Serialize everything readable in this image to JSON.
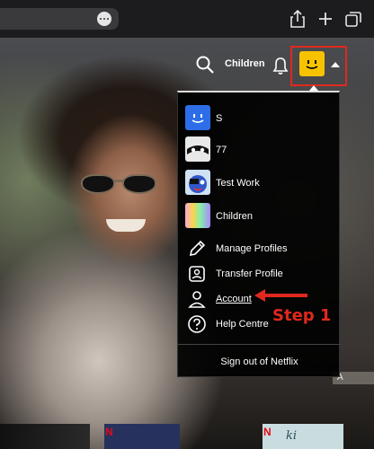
{
  "browser": {
    "icons": [
      "more-icon",
      "share-icon",
      "plus-icon",
      "tabs-icon"
    ]
  },
  "header": {
    "children_link": "Children",
    "icons": [
      "search-icon",
      "bell-icon",
      "caret-down-icon"
    ],
    "avatar_color": "#f7c200"
  },
  "menu": {
    "profiles": [
      {
        "name": "S",
        "avatar_color": "#2d6ee8"
      },
      {
        "name": "77",
        "avatar_color": "#e8e8e8"
      },
      {
        "name": "Test Work",
        "avatar_color": "#cfe1f3"
      },
      {
        "name": "Children",
        "avatar_color": "#fcd34d"
      }
    ],
    "items": [
      {
        "label": "Manage Profiles",
        "icon": "pencil-icon"
      },
      {
        "label": "Transfer Profile",
        "icon": "transfer-profile-icon"
      },
      {
        "label": "Account",
        "icon": "person-icon"
      },
      {
        "label": "Help Centre",
        "icon": "help-icon"
      }
    ],
    "sign_out": "Sign out of Netflix"
  },
  "annotation": {
    "step_label": "Step 1",
    "color": "#e0281e"
  },
  "background": {
    "edge_text": "A",
    "thumb_badge": "N",
    "thumb_title": "ki"
  }
}
